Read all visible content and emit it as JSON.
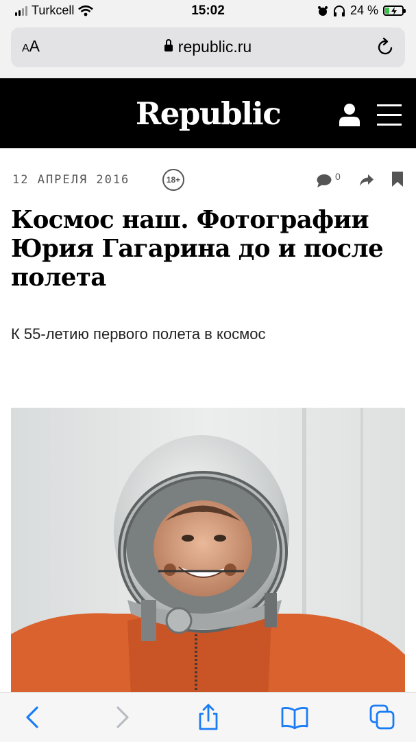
{
  "status_bar": {
    "carrier": "Turkcell",
    "time": "15:02",
    "battery": "24 %",
    "battery_level": 0.24
  },
  "browser": {
    "text_size_button": "AA",
    "url": "republic.ru"
  },
  "site": {
    "logo": "Republic"
  },
  "article": {
    "date": "12 АПРЕЛЯ 2016",
    "age_rating": "18+",
    "comment_count": "0",
    "title": "Космос наш. Фотографии Юрия Гагарина до и после полета",
    "subtitle": "К 55-летию первого полета в космос"
  },
  "icons": {
    "header": [
      "user-icon",
      "menu-icon"
    ],
    "meta": [
      "comment-icon",
      "share-icon",
      "bookmark-icon"
    ],
    "toolbar": [
      "back-icon",
      "forward-icon",
      "share-icon",
      "bookmarks-icon",
      "tabs-icon"
    ]
  },
  "colors": {
    "header_bg": "#000000",
    "ios_blue": "#1a7cf5",
    "meta_gray": "#555555",
    "suit_orange": "#d9622e"
  }
}
